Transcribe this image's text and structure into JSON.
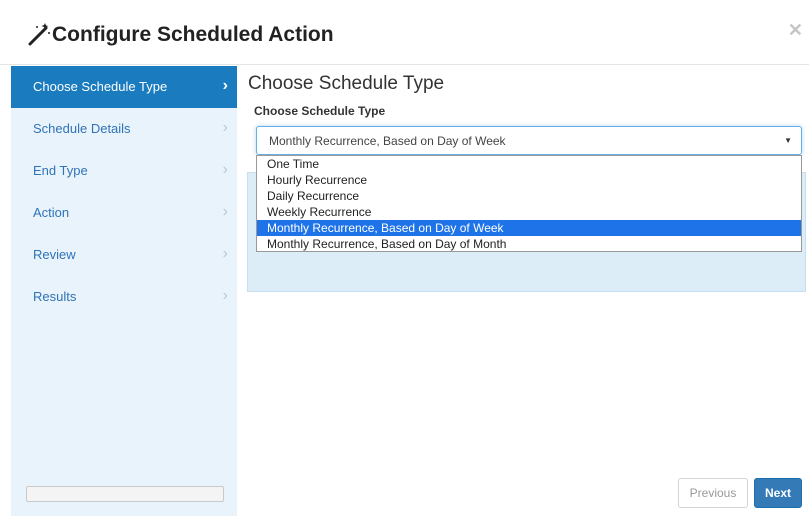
{
  "header": {
    "title": "Configure Scheduled Action",
    "icon": "magic-wand-icon",
    "close_icon": "close-icon"
  },
  "sidebar": {
    "items": [
      {
        "label": "Choose Schedule Type",
        "active": true
      },
      {
        "label": "Schedule Details",
        "active": false
      },
      {
        "label": "End Type",
        "active": false
      },
      {
        "label": "Action",
        "active": false
      },
      {
        "label": "Review",
        "active": false
      },
      {
        "label": "Results",
        "active": false
      }
    ],
    "chevron": "›",
    "progress": 0.0
  },
  "main": {
    "heading": "Choose Schedule Type",
    "field_label": "Choose Schedule Type",
    "select": {
      "value": "Monthly Recurrence, Based on Day of Week",
      "caret": "▼",
      "options": [
        "One Time",
        "Hourly Recurrence",
        "Daily Recurrence",
        "Weekly Recurrence",
        "Monthly Recurrence, Based on Day of Week",
        "Monthly Recurrence, Based on Day of Month"
      ],
      "selected_index": 4
    }
  },
  "footer": {
    "previous_label": "Previous",
    "next_label": "Next"
  },
  "colors": {
    "accent": "#1a7bbf",
    "sidebar_bg": "#e9f3fb",
    "selected_option": "#1e73e8",
    "next_button": "#337ab7"
  }
}
